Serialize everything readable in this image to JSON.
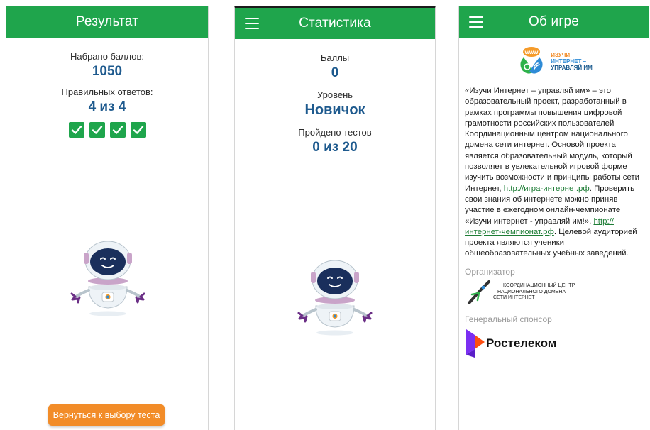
{
  "result_screen": {
    "title": "Результат",
    "score_label": "Набрано баллов:",
    "score_value": "1050",
    "correct_label": "Правильных ответов:",
    "correct_value": "4 из 4",
    "checks": 4,
    "back_button": "Вернуться к выбору теста"
  },
  "stats_screen": {
    "title": "Статистика",
    "points_label": "Баллы",
    "points_value": "0",
    "level_label": "Уровень",
    "level_value": "Новичок",
    "tests_label": "Пройдено тестов",
    "tests_value": "0 из 20"
  },
  "about_screen": {
    "title": "Об игре",
    "logo_badge": "www",
    "logo_text_1": "ИЗУЧИ",
    "logo_text_2": "ИНТЕРНЕТ –",
    "logo_text_3": "УПРАВЛЯЙ ИМ",
    "text_part1": "«Изучи Интернет – управляй им» – это образовательный проект, разработанный в рамках программы повышения цифровой грамотности российских пользователей Координационным центром национального домена сети интернет. Основой проекта является образовательный модуль, который позволяет в увлекательной игровой форме изучить возможности и принципы работы сети Интернет, ",
    "link1": "http://игра-интернет.рф",
    "text_part2": ". Проверить свои знания об интернете можно приняв участие в ежегодном онлайн-чемпионате «Изучи интернет - управляй им!», ",
    "link2": "http://интернет-чемпионат.рф",
    "text_part3": ". Целевой аудиторией проекта являются ученики общеобразовательных учебных заведений.",
    "organizer_label": "Организатор",
    "organizer_line1": "КООРДИНАЦИОННЫЙ ЦЕНТР",
    "organizer_line2": "НАЦИОНАЛЬНОГО ДОМЕНА",
    "organizer_line3": "СЕТИ ИНТЕРНЕТ",
    "sponsor_label": "Генеральный спонсор",
    "sponsor_name": "Ростелеком"
  },
  "colors": {
    "green": "#1fa54c",
    "blue_text": "#1e5a8e",
    "orange": "#f28c28",
    "rostelecom_purple": "#7b2ff2"
  }
}
